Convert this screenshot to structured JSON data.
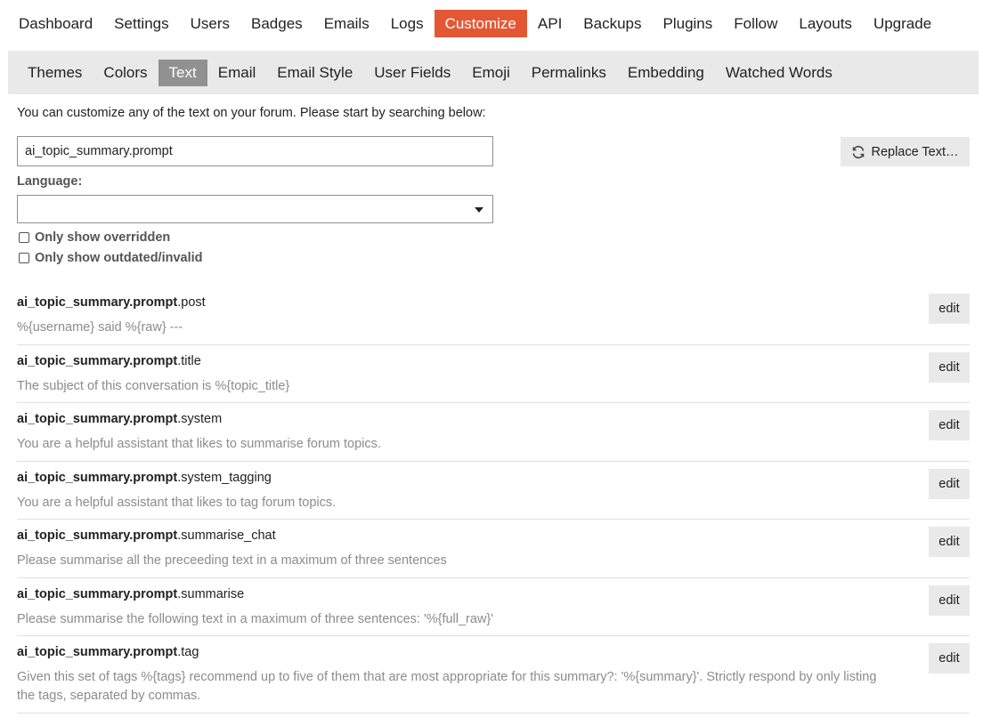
{
  "top_nav": [
    "Dashboard",
    "Settings",
    "Users",
    "Badges",
    "Emails",
    "Logs",
    "Customize",
    "API",
    "Backups",
    "Plugins",
    "Follow",
    "Layouts",
    "Upgrade"
  ],
  "top_nav_active": "Customize",
  "sub_nav": [
    "Themes",
    "Colors",
    "Text",
    "Email",
    "Email Style",
    "User Fields",
    "Emoji",
    "Permalinks",
    "Embedding",
    "Watched Words"
  ],
  "sub_nav_active": "Text",
  "intro": "You can customize any of the text on your forum. Please start by searching below:",
  "search": {
    "value": "ai_topic_summary.prompt"
  },
  "replace_button": {
    "label": "Replace Text…",
    "icon": "sync-icon"
  },
  "language": {
    "label": "Language:",
    "selected": ""
  },
  "filters": [
    {
      "label": "Only show overridden",
      "checked": false
    },
    {
      "label": "Only show outdated/invalid",
      "checked": false
    }
  ],
  "results": [
    {
      "key_prefix": "ai_topic_summary.prompt",
      "key_suffix": ".post",
      "value": "%{username} said %{raw} ---",
      "edit_label": "edit"
    },
    {
      "key_prefix": "ai_topic_summary.prompt",
      "key_suffix": ".title",
      "value": "The subject of this conversation is %{topic_title}",
      "edit_label": "edit"
    },
    {
      "key_prefix": "ai_topic_summary.prompt",
      "key_suffix": ".system",
      "value": "You are a helpful assistant that likes to summarise forum topics.",
      "edit_label": "edit"
    },
    {
      "key_prefix": "ai_topic_summary.prompt",
      "key_suffix": ".system_tagging",
      "value": "You are a helpful assistant that likes to tag forum topics.",
      "edit_label": "edit"
    },
    {
      "key_prefix": "ai_topic_summary.prompt",
      "key_suffix": ".summarise_chat",
      "value": "Please summarise all the preceeding text in a maximum of three sentences",
      "edit_label": "edit"
    },
    {
      "key_prefix": "ai_topic_summary.prompt",
      "key_suffix": ".summarise",
      "value": "Please summarise the following text in a maximum of three sentences: '%{full_raw}'",
      "edit_label": "edit"
    },
    {
      "key_prefix": "ai_topic_summary.prompt",
      "key_suffix": ".tag",
      "value": "Given this set of tags %{tags} recommend up to five of them that are most appropriate for this summary?: '%{summary}'. Strictly respond by only listing the tags, separated by commas.",
      "edit_label": "edit"
    }
  ],
  "colors": {
    "accent": "#e45735",
    "subnav_bg": "#e9e9e9",
    "subnav_active": "#919191"
  }
}
